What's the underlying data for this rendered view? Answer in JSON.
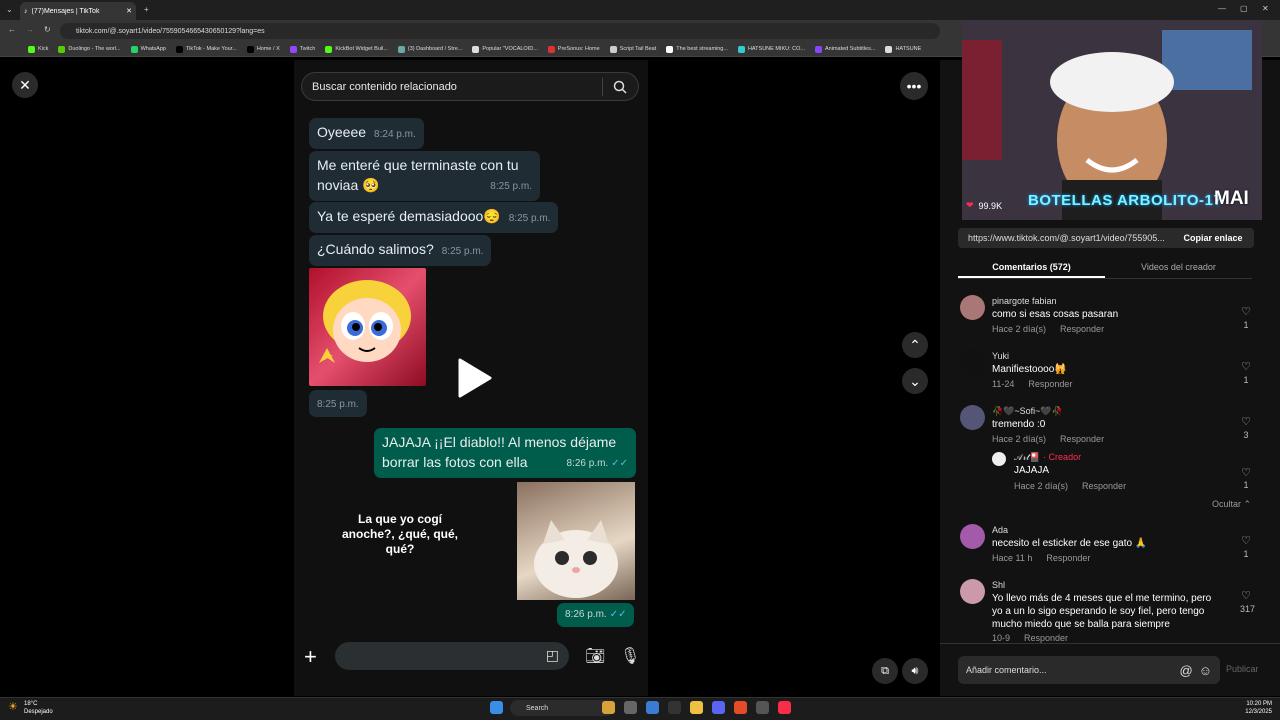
{
  "browser": {
    "tab_title": "(77)Mensajes | TikTok",
    "url": "tiktok.com/@.soyart1/video/7559054665430650129?lang=es",
    "bookmarks": [
      "Kick",
      "Duolingo - The worl...",
      "WhatsApp",
      "TikTok - Make Your...",
      "Home / X",
      "Twitch",
      "KickBot Widget Buil...",
      "(3) Dashboard / Stre...",
      "Popular \"VOCALOID...",
      "PreSonus: Home",
      "Script Tail Beat",
      "The best streaming...",
      "HATSUNE MIKU: CO...",
      "Animated Subtitles...",
      "HATSUNE"
    ]
  },
  "video": {
    "search_placeholder": "Buscar contenido relacionado",
    "messages": [
      {
        "text": "Oyeeee",
        "time": "8:24 p.m."
      },
      {
        "text": "Me enteré que terminaste con tu",
        "text2": "noviaa 🥺",
        "time": "8:25 p.m."
      },
      {
        "text": "Ya te esperé demasiadooo😔",
        "time": "8:25 p.m."
      },
      {
        "text": "¿Cuándo salimos?",
        "time": "8:25 p.m."
      }
    ],
    "sticker_time": "8:25 p.m.",
    "outgoing_line1": "JAJAJA ¡¡El diablo!! Al menos déjame",
    "outgoing_line2": "borrar las fotos con ella",
    "outgoing_time": "8:26 p.m.",
    "sticker_caption": "La que yo cogí anoche?, ¿qué, qué, qué?",
    "cat_time": "8:26 p.m."
  },
  "stream": {
    "overlay_text": "BOTELLAS ARBOLITO-17",
    "overlay_tag": "MAI",
    "likes": "99.9K"
  },
  "panel": {
    "link": "https://www.tiktok.com/@.soyart1/video/755905...",
    "copy_label": "Copiar enlace",
    "tab_comments": "Comentarios (572)",
    "tab_videos": "Videos del creador",
    "comments": [
      {
        "name": "pinargote fabian",
        "text": "como si esas cosas pasaran",
        "date": "Hace 2 día(s)",
        "reply": "Responder",
        "likes": "1"
      },
      {
        "name": "Yuki",
        "text": "Manifiestoooo🙀",
        "date": "11-24",
        "reply": "Responder",
        "likes": "1"
      },
      {
        "name": "🥀🖤~Sofi~🖤🥀",
        "text": "tremendo :0",
        "date": "Hace 2 día(s)",
        "reply": "Responder",
        "likes": "3"
      },
      {
        "name": "Ada",
        "text": "necesito el esticker de ese gato 🙏",
        "date": "Hace 11 h",
        "reply": "Responder",
        "likes": "1"
      },
      {
        "name": "Shl",
        "text": "Yo llevo más de 4 meses que el me termino, pero yo a un lo sigo esperando le soy fiel, pero tengo mucho miedo que se balla para siempre",
        "date": "10-9",
        "reply": "Responder",
        "likes": "317"
      }
    ],
    "creator_reply": {
      "name": "𝒜𝓇𝓉🎴",
      "badge": "· Creador",
      "text": "JAJAJA",
      "date": "Hace 2 día(s)",
      "reply": "Responder",
      "likes": "1"
    },
    "hide_label": "Ocultar",
    "add_comment": "Añadir comentario...",
    "publish": "Publicar"
  },
  "taskbar": {
    "temp": "18°C",
    "weather": "Despejado",
    "search": "Search",
    "time": "10:20 PM",
    "date": "12/3/2025"
  }
}
